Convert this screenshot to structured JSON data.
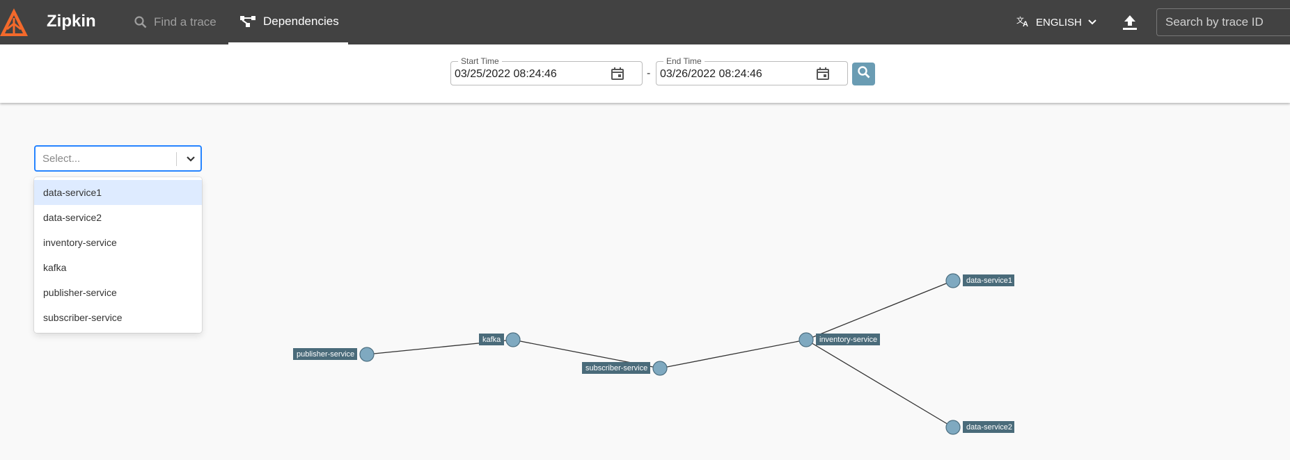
{
  "app": {
    "brand": "Zipkin"
  },
  "nav": {
    "find_trace": "Find a trace",
    "dependencies": "Dependencies"
  },
  "header": {
    "language": "ENGLISH",
    "trace_search_placeholder": "Search by trace ID"
  },
  "time_range": {
    "start_label": "Start Time",
    "start_value": "03/25/2022 08:24:46",
    "separator": "-",
    "end_label": "End Time",
    "end_value": "03/26/2022 08:24:46"
  },
  "service_select": {
    "placeholder": "Select...",
    "options": [
      "data-service1",
      "data-service2",
      "inventory-service",
      "kafka",
      "publisher-service",
      "subscriber-service"
    ]
  },
  "graph": {
    "nodes": {
      "publisher": "publisher-service",
      "kafka": "kafka",
      "subscriber": "subscriber-service",
      "inventory": "inventory-service",
      "data1": "data-service1",
      "data2": "data-service2"
    },
    "edges": [
      [
        "publisher-service",
        "kafka"
      ],
      [
        "kafka",
        "subscriber-service"
      ],
      [
        "subscriber-service",
        "inventory-service"
      ],
      [
        "inventory-service",
        "data-service1"
      ],
      [
        "inventory-service",
        "data-service2"
      ]
    ]
  },
  "colors": {
    "topbar": "#424242",
    "logo_accent": "#f3692b",
    "search_button": "#6a9cb3",
    "node_fill": "#7fa9c0",
    "node_label_bg": "#4a6b7a",
    "select_focus": "#2684ff",
    "option_focus": "#deebff"
  }
}
